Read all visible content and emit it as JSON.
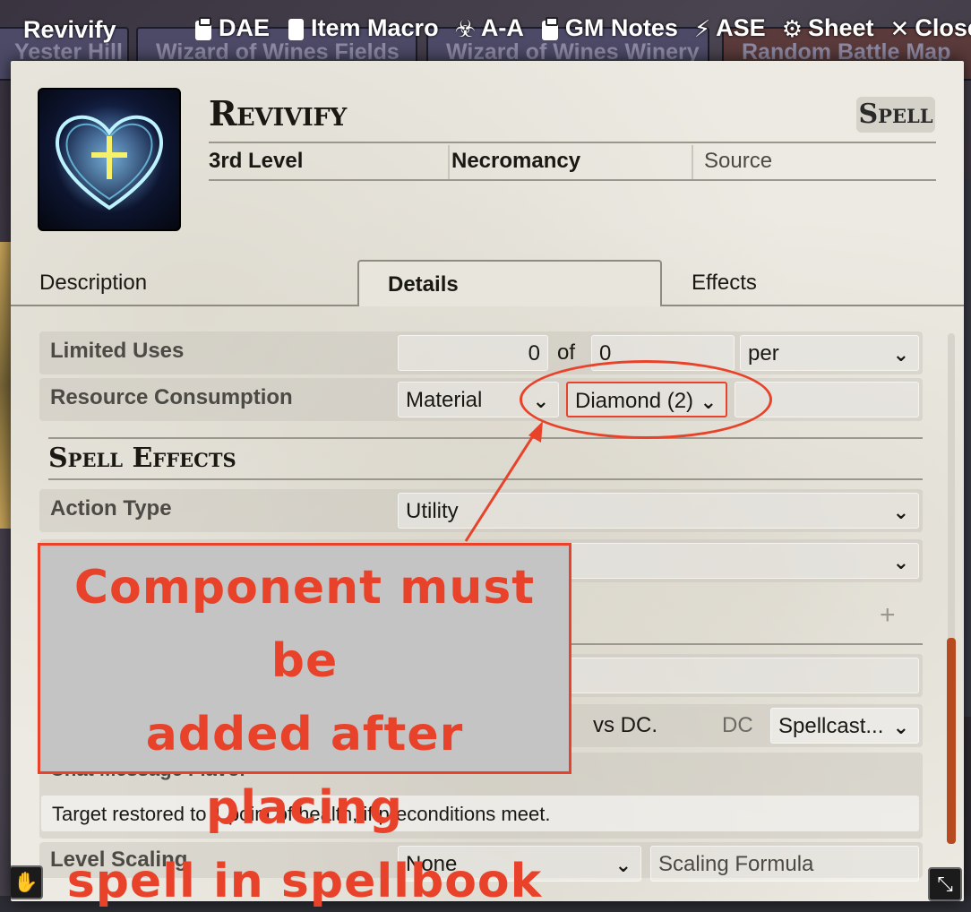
{
  "background": {
    "tabs": [
      "Yester Hill",
      "Wizard of Wines Fields",
      "Wizard of Wines Winery",
      "Random Battle Map"
    ]
  },
  "window": {
    "title": "Revivify",
    "controls": [
      {
        "icon": "clipboard-icon",
        "label": "DAE"
      },
      {
        "icon": "note-icon",
        "label": "Item Macro"
      },
      {
        "icon": "biohazard-icon",
        "label": "A-A"
      },
      {
        "icon": "clipboard-icon",
        "label": "GM Notes"
      },
      {
        "icon": "wand-icon",
        "label": "ASE"
      },
      {
        "icon": "gear-icon",
        "label": "Sheet"
      },
      {
        "icon": "close-icon",
        "label": "Close"
      }
    ]
  },
  "item": {
    "name": "Revivify",
    "type": "Spell",
    "level": "3rd Level",
    "school": "Necromancy",
    "source_placeholder": "Source"
  },
  "tabs": [
    "Description",
    "Details",
    "Effects"
  ],
  "active_tab": "Details",
  "limited_uses": {
    "label": "Limited Uses",
    "value": "0",
    "of": "of",
    "max": "0",
    "per": "per"
  },
  "resource_consumption": {
    "label": "Resource Consumption",
    "type": "Material",
    "target": "Diamond (2)",
    "amount": ""
  },
  "spell_effects": {
    "title": "Spell Effects",
    "action_type_label": "Action Type",
    "action_type": "Utility"
  },
  "save": {
    "vs_dc": "vs DC.",
    "dc_label": "DC",
    "dc_source": "Spellcast..."
  },
  "chat_flavor": {
    "label": "Chat Message Flavor",
    "value": "Target restored to 1 point of health, if preconditions meet."
  },
  "level_scaling": {
    "label": "Level Scaling",
    "mode": "None",
    "formula_placeholder": "Scaling Formula"
  },
  "annotation": {
    "line1": "Component must be",
    "line2": "added after placing",
    "line3": "spell in spellbook",
    "color": "#e8432a"
  },
  "colors": {
    "sheet_bg": "#eceae2",
    "scroll_thumb": "#b84a20"
  }
}
